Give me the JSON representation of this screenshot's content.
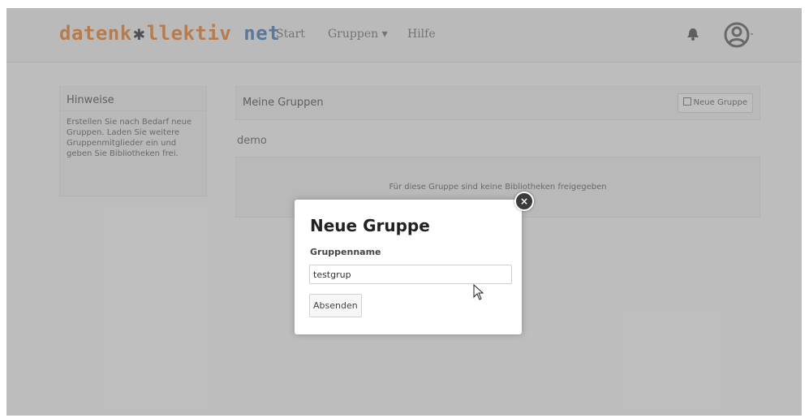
{
  "brand": {
    "part1": "datenk",
    "star": "✱",
    "part2": "llektiv",
    "part3": " net"
  },
  "nav": {
    "links": [
      "Start",
      "Gruppen ▾",
      "Hilfe"
    ]
  },
  "icons": {
    "bell": "bell-icon",
    "user": "user-icon",
    "close": "close-icon",
    "square": "square-icon",
    "cursor": "mouse-pointer-icon"
  },
  "sidebar": {
    "title": "Hinweise",
    "text": "Erstellen Sie nach Bedarf neue Gruppen. Laden Sie weitere Gruppenmitglieder ein und geben Sie Bibliotheken frei."
  },
  "main": {
    "title": "Meine Gruppen",
    "new_group_button": "Neue Gruppe",
    "group_name": "demo",
    "group_empty": "Für diese Gruppe sind keine Bibliotheken freigegeben"
  },
  "modal": {
    "title": "Neue Gruppe",
    "label": "Gruppenname",
    "input_value": "testgrup",
    "submit": "Absenden",
    "close_symbol": "×"
  },
  "colors": {
    "brand_orange": "#e8873a",
    "brand_blue": "#4a82b4"
  }
}
